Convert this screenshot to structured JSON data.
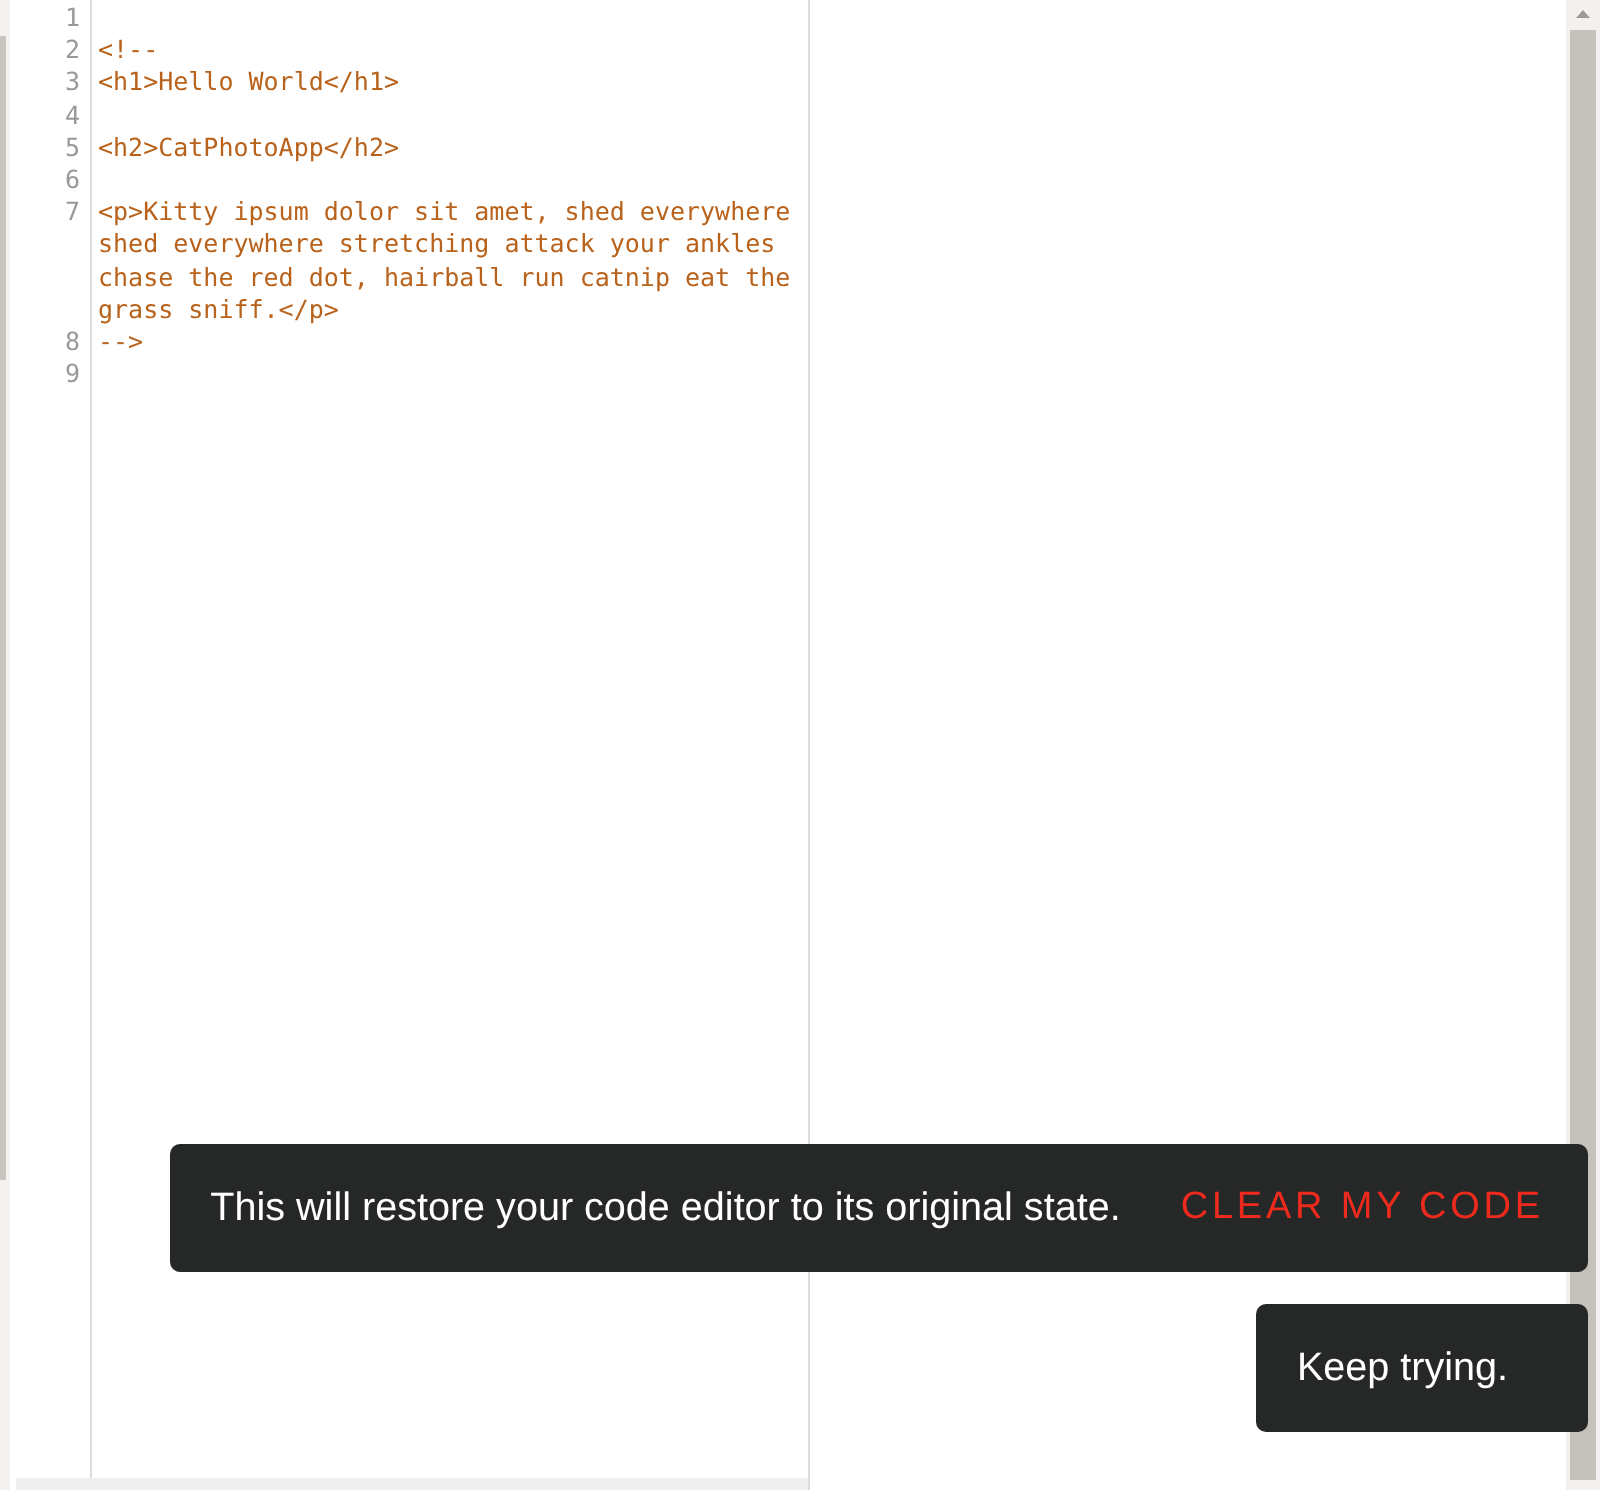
{
  "editor": {
    "lines": [
      {
        "number": "1"
      },
      {
        "number": "2",
        "text": "<!--"
      },
      {
        "number": "3",
        "text": "<h1>Hello World</h1>"
      },
      {
        "number": "4"
      },
      {
        "number": "5",
        "text": "<h2>CatPhotoApp</h2>"
      },
      {
        "number": "6"
      },
      {
        "number": "7",
        "text": "<p>Kitty ipsum dolor sit amet, shed everywhere shed everywhere stretching attack your ankles chase the red dot, hairball run catnip eat the grass sniff.</p>"
      },
      {
        "number": "8",
        "text": "-->"
      },
      {
        "number": "9"
      }
    ]
  },
  "toasts": [
    {
      "message": "This will restore your code editor to its original state.",
      "action": "CLEAR MY CODE"
    },
    {
      "message": "Keep trying."
    }
  ]
}
